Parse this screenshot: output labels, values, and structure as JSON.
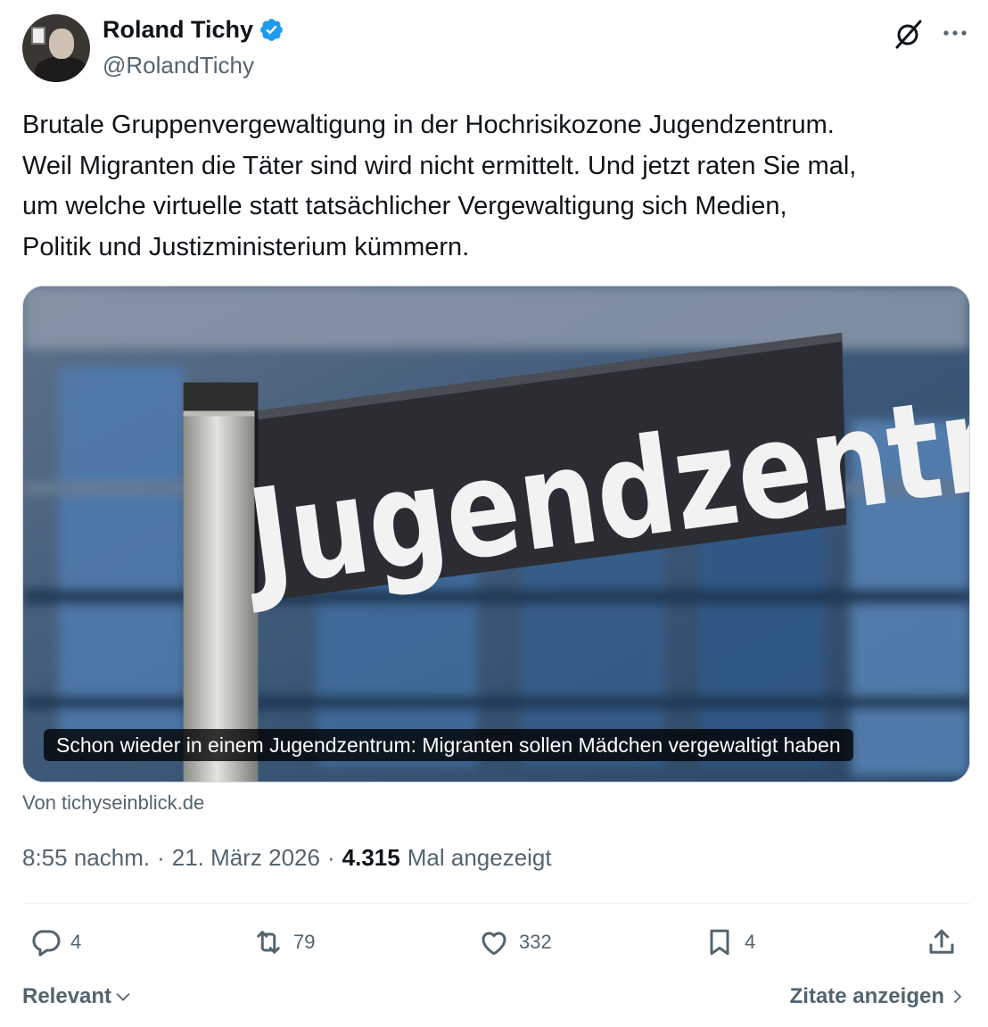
{
  "author": {
    "name": "Roland Tichy",
    "handle": "@RolandTichy",
    "verified": true,
    "avatar_icon": "avatar"
  },
  "tweet": {
    "text": "Brutale Gruppenvergewaltigung in der Hochrisikozone Jugendzentrum.\nWeil Migranten die Täter sind wird nicht ermittelt. Und jetzt raten Sie mal,\num welche virtuelle statt tatsächlicher Vergewaltigung sich Medien,\nPolitik und Justizministerium kümmern."
  },
  "card": {
    "sign_text": "Jugendzentrum",
    "caption": "Schon wieder in einem Jugendzentrum: Migranten sollen Mädchen vergewaltigt haben",
    "source": "Von tichyseinblick.de"
  },
  "meta": {
    "time": "8:55 nachm.",
    "separator": "·",
    "date": "21. März 2026",
    "views": "4.315",
    "views_label": "Mal angezeigt"
  },
  "actions": {
    "replies": "4",
    "reposts": "79",
    "likes": "332",
    "bookmarks": "4"
  },
  "footer": {
    "sort_label": "Relevant",
    "quotes_label": "Zitate anzeigen"
  },
  "colors": {
    "text_primary": "#0f1419",
    "text_secondary": "#536471",
    "verified_blue": "#1d9bf0",
    "divider": "#eff3f4"
  },
  "icons": [
    "verified-badge-icon",
    "grok-icon",
    "more-icon",
    "reply-icon",
    "repost-icon",
    "like-icon",
    "bookmark-icon",
    "share-icon",
    "chevron-down-icon",
    "chevron-right-icon"
  ]
}
